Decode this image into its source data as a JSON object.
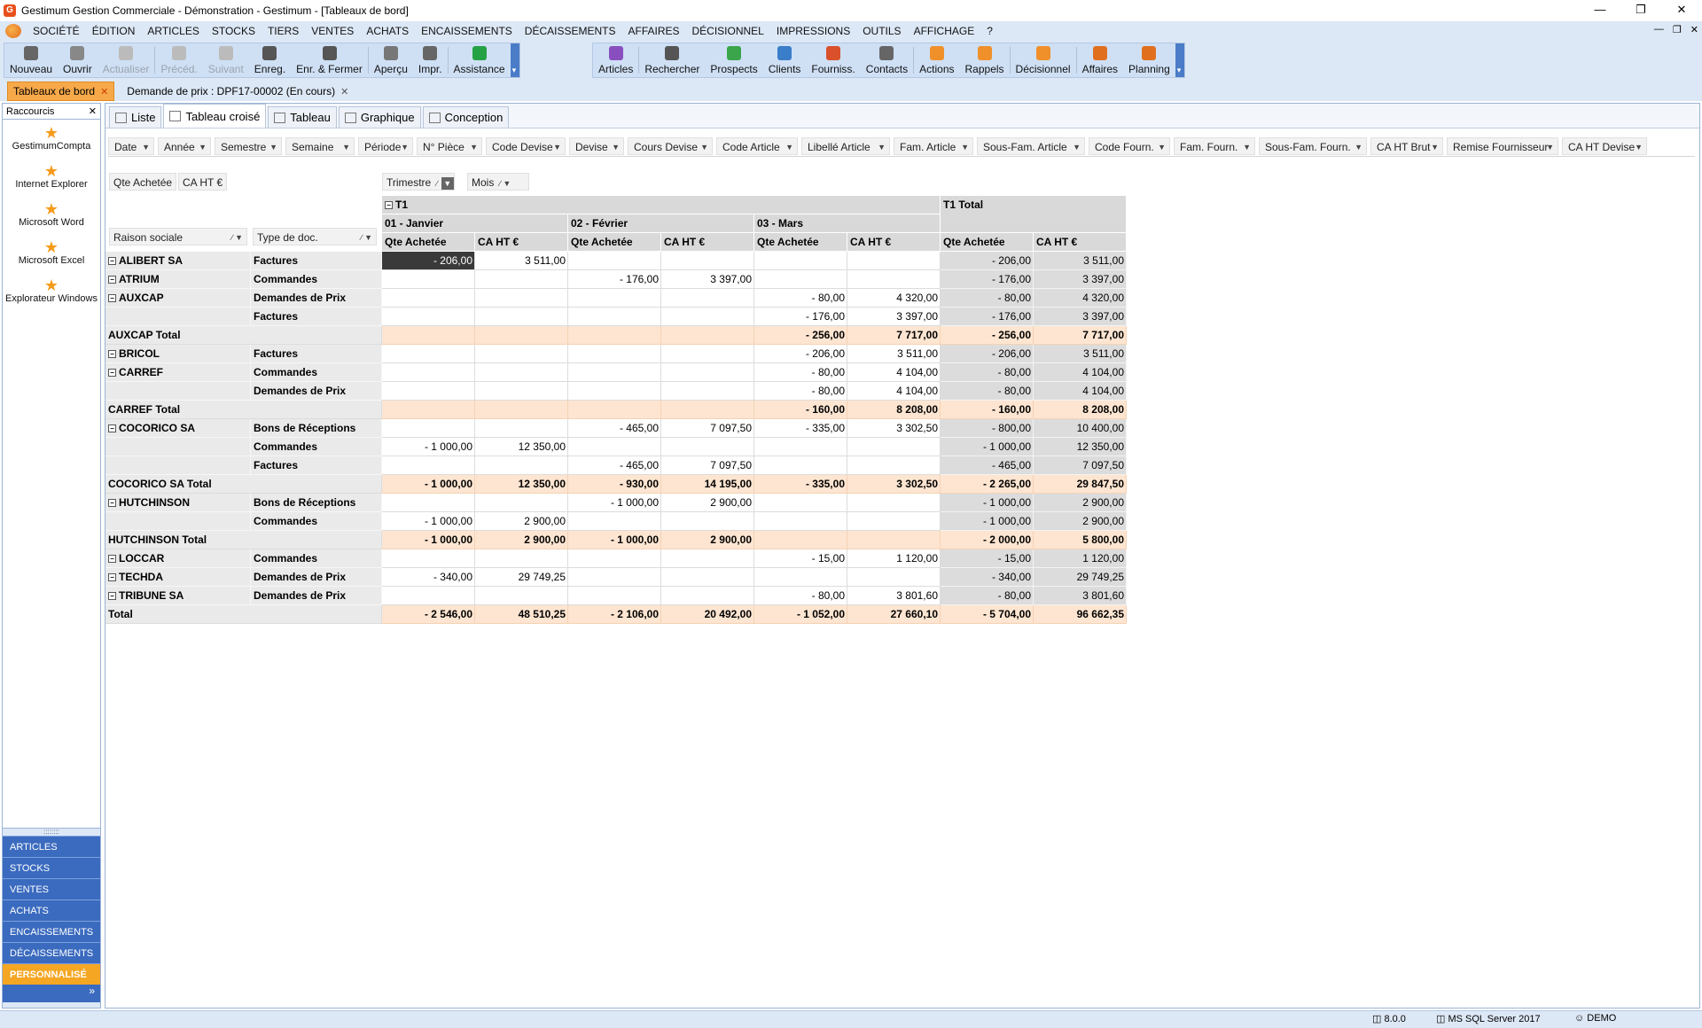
{
  "window": {
    "title": "Gestimum Gestion Commerciale - Démonstration - Gestimum - [Tableaux de bord]"
  },
  "menu": [
    "SOCIÉTÉ",
    "ÉDITION",
    "ARTICLES",
    "STOCKS",
    "TIERS",
    "VENTES",
    "ACHATS",
    "ENCAISSEMENTS",
    "DÉCAISSEMENTS",
    "AFFAIRES",
    "DÉCISIONNEL",
    "IMPRESSIONS",
    "OUTILS",
    "AFFICHAGE",
    "?"
  ],
  "toolbar": {
    "group1": [
      {
        "label": "Nouveau",
        "icon": "plus-icon",
        "color": "#666666"
      },
      {
        "label": "Ouvrir",
        "icon": "folder-icon",
        "color": "#888888"
      },
      {
        "label": "Actualiser",
        "icon": "refresh-icon",
        "disabled": true,
        "color": "#bbbbbb"
      },
      {
        "label": "Précéd.",
        "icon": "chevron-left-icon",
        "disabled": true,
        "color": "#bbbbbb"
      },
      {
        "label": "Suivant",
        "icon": "chevron-right-icon",
        "disabled": true,
        "color": "#bbbbbb"
      },
      {
        "label": "Enreg.",
        "icon": "save-icon",
        "color": "#555555"
      },
      {
        "label": "Enr. & Fermer",
        "icon": "save-close-icon",
        "color": "#555555"
      },
      {
        "label": "Aperçu",
        "icon": "preview-icon",
        "color": "#777777"
      },
      {
        "label": "Impr.",
        "icon": "print-icon",
        "color": "#666666"
      },
      {
        "label": "Assistance",
        "icon": "whatsapp-icon",
        "color": "#25a244"
      }
    ],
    "group2": [
      {
        "label": "Articles",
        "icon": "cube-icon",
        "color": "#8a4fbf"
      },
      {
        "label": "Rechercher",
        "icon": "search-user-icon",
        "color": "#555555"
      },
      {
        "label": "Prospects",
        "icon": "person-icon",
        "color": "#3aa54a"
      },
      {
        "label": "Clients",
        "icon": "person-icon",
        "color": "#3a7dc8"
      },
      {
        "label": "Fourniss.",
        "icon": "person-icon",
        "color": "#d9502a"
      },
      {
        "label": "Contacts",
        "icon": "contacts-icon",
        "color": "#666666"
      },
      {
        "label": "Actions",
        "icon": "check-icon",
        "color": "#f0902a"
      },
      {
        "label": "Rappels",
        "icon": "bell-icon",
        "color": "#f0902a"
      },
      {
        "label": "Décisionnel",
        "icon": "pie-chart-icon",
        "color": "#f0902a"
      },
      {
        "label": "Affaires",
        "icon": "bar-chart-icon",
        "color": "#e07020"
      },
      {
        "label": "Planning",
        "icon": "calendar-icon",
        "color": "#e07020"
      }
    ]
  },
  "doc_tabs": [
    {
      "label": "Tableaux de bord",
      "active": true
    },
    {
      "label": "Demande de prix : DPF17-00002 (En cours)",
      "active": false
    }
  ],
  "left_panel": {
    "title": "Raccourcis",
    "shortcuts": [
      "GestimumCompta",
      "Internet Explorer",
      "Microsoft Word",
      "Microsoft Excel",
      "Explorateur Windows"
    ],
    "modules": [
      "ARTICLES",
      "STOCKS",
      "VENTES",
      "ACHATS",
      "ENCAISSEMENTS",
      "DÉCAISSEMENTS",
      "PERSONNALISÉ"
    ],
    "active_module": "PERSONNALISÉ"
  },
  "view_tabs": [
    {
      "label": "Liste",
      "active": false
    },
    {
      "label": "Tableau croisé",
      "active": true
    },
    {
      "label": "Tableau",
      "active": false
    },
    {
      "label": "Graphique",
      "active": false
    },
    {
      "label": "Conception",
      "active": false
    }
  ],
  "filter_fields": [
    "Date",
    "Année",
    "Semestre",
    "Semaine",
    "Période",
    "N° Pièce",
    "Code Devise",
    "Devise",
    "Cours Devise",
    "Code Article",
    "Libellé Article",
    "Fam. Article",
    "Sous-Fam. Article",
    "Code Fourn.",
    "Fam. Fourn.",
    "Sous-Fam. Fourn.",
    "CA HT Brut",
    "Remise Fournisseur",
    "CA HT Devise"
  ],
  "data_fields": [
    "Qte Achetée",
    "CA HT €"
  ],
  "column_fields": [
    "Trimestre",
    "Mois"
  ],
  "row_fields": [
    "Raison sociale",
    "Type de doc."
  ],
  "pivot": {
    "quarter": "T1",
    "quarter_total": "T1 Total",
    "months": [
      "01 - Janvier",
      "02 - Février",
      "03 - Mars"
    ],
    "measures": [
      "Qte Achetée",
      "CA HT €"
    ],
    "rows": [
      {
        "kind": "group",
        "name": "ALIBERT SA",
        "type": "Factures",
        "v": [
          "- 206,00",
          "3 511,00",
          "",
          "",
          "",
          "",
          "- 206,00",
          "3 511,00"
        ],
        "selected": 0
      },
      {
        "kind": "group",
        "name": "ATRIUM",
        "type": "Commandes",
        "v": [
          "",
          "",
          "- 176,00",
          "3 397,00",
          "",
          "",
          "- 176,00",
          "3 397,00"
        ]
      },
      {
        "kind": "group",
        "name": "AUXCAP",
        "type": "Demandes de Prix",
        "v": [
          "",
          "",
          "",
          "",
          "- 80,00",
          "4 320,00",
          "- 80,00",
          "4 320,00"
        ]
      },
      {
        "kind": "child",
        "name": "",
        "type": "Factures",
        "v": [
          "",
          "",
          "",
          "",
          "- 176,00",
          "3 397,00",
          "- 176,00",
          "3 397,00"
        ]
      },
      {
        "kind": "subtotal",
        "name": "AUXCAP Total",
        "v": [
          "",
          "",
          "",
          "",
          "- 256,00",
          "7 717,00",
          "- 256,00",
          "7 717,00"
        ]
      },
      {
        "kind": "group",
        "name": "BRICOL",
        "type": "Factures",
        "v": [
          "",
          "",
          "",
          "",
          "- 206,00",
          "3 511,00",
          "- 206,00",
          "3 511,00"
        ]
      },
      {
        "kind": "group",
        "name": "CARREF",
        "type": "Commandes",
        "v": [
          "",
          "",
          "",
          "",
          "- 80,00",
          "4 104,00",
          "- 80,00",
          "4 104,00"
        ]
      },
      {
        "kind": "child",
        "name": "",
        "type": "Demandes de Prix",
        "v": [
          "",
          "",
          "",
          "",
          "- 80,00",
          "4 104,00",
          "- 80,00",
          "4 104,00"
        ]
      },
      {
        "kind": "subtotal",
        "name": "CARREF Total",
        "v": [
          "",
          "",
          "",
          "",
          "- 160,00",
          "8 208,00",
          "- 160,00",
          "8 208,00"
        ]
      },
      {
        "kind": "group",
        "name": "COCORICO SA",
        "type": "Bons de Réceptions",
        "v": [
          "",
          "",
          "- 465,00",
          "7 097,50",
          "- 335,00",
          "3 302,50",
          "- 800,00",
          "10 400,00"
        ]
      },
      {
        "kind": "child",
        "name": "",
        "type": "Commandes",
        "v": [
          "- 1 000,00",
          "12 350,00",
          "",
          "",
          "",
          "",
          "- 1 000,00",
          "12 350,00"
        ]
      },
      {
        "kind": "child",
        "name": "",
        "type": "Factures",
        "v": [
          "",
          "",
          "- 465,00",
          "7 097,50",
          "",
          "",
          "- 465,00",
          "7 097,50"
        ]
      },
      {
        "kind": "subtotal",
        "name": "COCORICO SA Total",
        "v": [
          "- 1 000,00",
          "12 350,00",
          "- 930,00",
          "14 195,00",
          "- 335,00",
          "3 302,50",
          "- 2 265,00",
          "29 847,50"
        ]
      },
      {
        "kind": "group",
        "name": "HUTCHINSON",
        "type": "Bons de Réceptions",
        "v": [
          "",
          "",
          "- 1 000,00",
          "2 900,00",
          "",
          "",
          "- 1 000,00",
          "2 900,00"
        ]
      },
      {
        "kind": "child",
        "name": "",
        "type": "Commandes",
        "v": [
          "- 1 000,00",
          "2 900,00",
          "",
          "",
          "",
          "",
          "- 1 000,00",
          "2 900,00"
        ]
      },
      {
        "kind": "subtotal",
        "name": "HUTCHINSON Total",
        "v": [
          "- 1 000,00",
          "2 900,00",
          "- 1 000,00",
          "2 900,00",
          "",
          "",
          "- 2 000,00",
          "5 800,00"
        ]
      },
      {
        "kind": "group",
        "name": "LOCCAR",
        "type": "Commandes",
        "v": [
          "",
          "",
          "",
          "",
          "- 15,00",
          "1 120,00",
          "- 15,00",
          "1 120,00"
        ]
      },
      {
        "kind": "group",
        "name": "TECHDA",
        "type": "Demandes de Prix",
        "v": [
          "- 340,00",
          "29 749,25",
          "",
          "",
          "",
          "",
          "- 340,00",
          "29 749,25"
        ]
      },
      {
        "kind": "group",
        "name": "TRIBUNE SA",
        "type": "Demandes de Prix",
        "v": [
          "",
          "",
          "",
          "",
          "- 80,00",
          "3 801,60",
          "- 80,00",
          "3 801,60"
        ]
      },
      {
        "kind": "total",
        "name": "Total",
        "v": [
          "- 2 546,00",
          "48 510,25",
          "- 2 106,00",
          "20 492,00",
          "- 1 052,00",
          "27 660,10",
          "- 5 704,00",
          "96 662,35"
        ]
      }
    ]
  },
  "status_bar": {
    "version": "8.0.0",
    "server": "MS SQL Server 2017",
    "user": "DEMO"
  },
  "colors": {
    "accent_orange": "#f5a623",
    "nav_blue": "#3b6bbf",
    "subtotal_bg": "#fde5d1"
  }
}
